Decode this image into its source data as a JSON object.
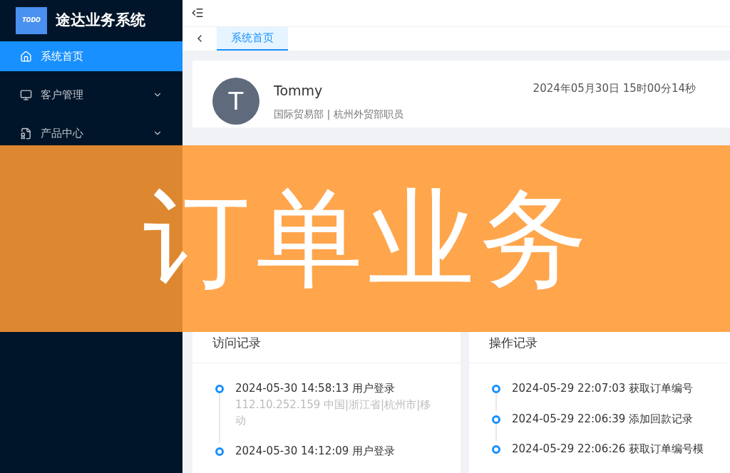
{
  "app": {
    "title": "途达业务系统",
    "logo_text": "TODO"
  },
  "sidebar": {
    "items": [
      {
        "label": "系统首页",
        "selected": true,
        "expandable": false
      },
      {
        "label": "客户管理",
        "selected": false,
        "expandable": true
      },
      {
        "label": "产品中心",
        "selected": false,
        "expandable": true
      }
    ]
  },
  "tabs": [
    {
      "label": "系统首页",
      "selected": true
    }
  ],
  "profile": {
    "avatar": "T",
    "name": "Tommy",
    "dept": "国际贸易部 | 杭州外贸部职员",
    "datetime": "2024年05月30日 15时00分14秒"
  },
  "visits": {
    "title": "访问记录",
    "entries": [
      {
        "text": "2024-05-30 14:58:13 用户登录",
        "detail": "112.10.252.159 中国|浙江省|杭州市|移动"
      },
      {
        "text": "2024-05-30 14:12:09 用户登录"
      }
    ]
  },
  "operations": {
    "title": "操作记录",
    "entries": [
      {
        "text": "2024-05-29 22:07:03 获取订单编号"
      },
      {
        "text": "2024-05-29 22:06:39 添加回款记录"
      },
      {
        "text": "2024-05-29 22:06:26 获取订单编号模"
      }
    ]
  },
  "banner": {
    "text": "订单业务"
  }
}
